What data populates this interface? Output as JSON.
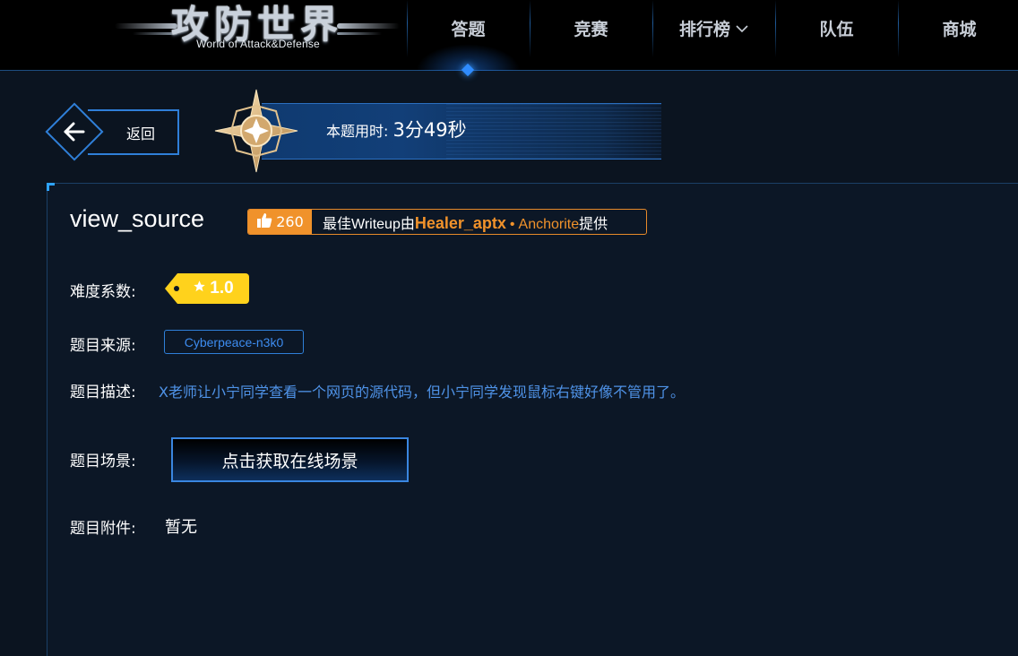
{
  "logo": {
    "title": "攻防世界",
    "subtitle": "World of Attack&Defense"
  },
  "nav": {
    "items": [
      {
        "label": "答题",
        "active": true
      },
      {
        "label": "竞赛"
      },
      {
        "label": "排行榜",
        "has_dropdown": true
      },
      {
        "label": "队伍"
      },
      {
        "label": "商城"
      }
    ]
  },
  "back": {
    "label": "返回",
    "icon": "arrow-left-icon"
  },
  "timer": {
    "prefix": "本题用时:",
    "value": "3分49秒",
    "icon": "compass-star-icon"
  },
  "challenge": {
    "title": "view_source",
    "writeup": {
      "likes": "260",
      "prefix": "最佳Writeup由",
      "author": "Healer_aptx",
      "dot": "•",
      "team": "Anchorite",
      "suffix": "提供",
      "icon": "thumbs-up-icon"
    },
    "difficulty": {
      "label": "难度系数:",
      "value": "1.0",
      "icon": "star-icon"
    },
    "source": {
      "label": "题目来源:",
      "value": "Cyberpeace-n3k0"
    },
    "description": {
      "label": "题目描述:",
      "value": "X老师让小宁同学查看一个网页的源代码，但小宁同学发现鼠标右键好像不管用了。"
    },
    "scene": {
      "label": "题目场景:",
      "button": "点击获取在线场景"
    },
    "attachment": {
      "label": "题目附件:",
      "value": "暂无"
    }
  },
  "colors": {
    "background": "#0b1420",
    "accent_blue": "#2f7fd8",
    "writeup_orange": "#f0922b",
    "difficulty_yellow": "#ffd21c",
    "description_blue": "#4f93e8"
  }
}
